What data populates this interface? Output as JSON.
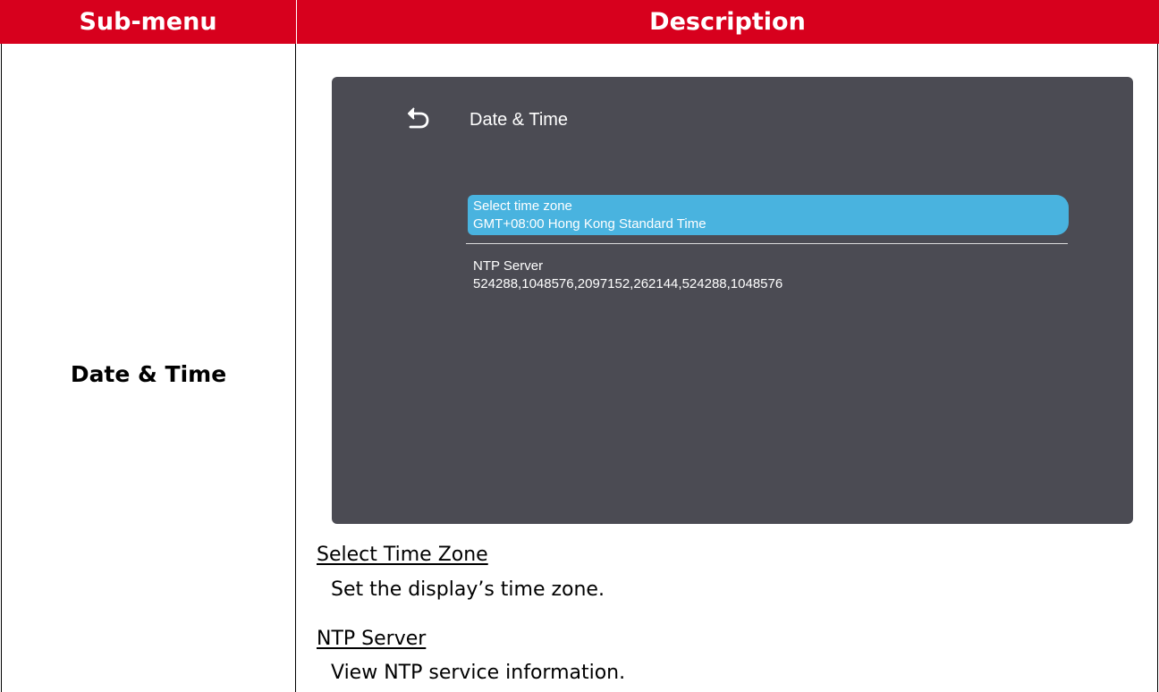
{
  "table": {
    "header_submenu": "Sub-menu",
    "header_description": "Description",
    "submenu_name": "Date & Time"
  },
  "screen": {
    "title": "Date & Time",
    "back_icon": "back-arrow-icon",
    "items": [
      {
        "label": "Select time zone",
        "value": "GMT+08:00 Hong Kong Standard Time",
        "selected": true
      },
      {
        "label": "NTP Server",
        "value": "524288,1048576,2097152,262144,524288,1048576",
        "selected": false
      }
    ],
    "colors": {
      "background": "#4b4b53",
      "highlight": "#49b3df"
    }
  },
  "descriptions": [
    {
      "heading": "Select Time Zone",
      "text": "Set the display’s time zone."
    },
    {
      "heading": "NTP Server",
      "text": "View NTP service information."
    }
  ],
  "colors": {
    "header_background": "#d7001d"
  }
}
